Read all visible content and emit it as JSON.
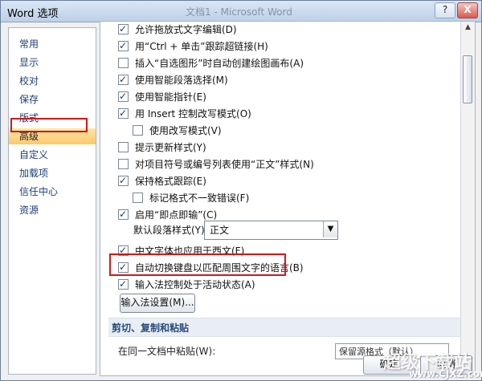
{
  "window": {
    "title": "Word 选项",
    "ghost_title": "文档1 - Microsoft Word"
  },
  "sysbuttons": {
    "help": "?",
    "close": "X"
  },
  "nav": [
    {
      "label": "常用"
    },
    {
      "label": "显示"
    },
    {
      "label": "校对"
    },
    {
      "label": "保存"
    },
    {
      "label": "版式"
    },
    {
      "label": "高级"
    },
    {
      "label": "自定义"
    },
    {
      "label": "加载项"
    },
    {
      "label": "信任中心"
    },
    {
      "label": "资源"
    }
  ],
  "options": [
    {
      "text": "允许拖放式文字编辑(D)",
      "checked": true
    },
    {
      "text": "用“Ctrl + 单击”跟踪超链接(H)",
      "checked": true
    },
    {
      "text": "插入“自选图形”时自动创建绘图画布(A)",
      "checked": false
    },
    {
      "text": "使用智能段落选择(M)",
      "checked": true
    },
    {
      "text": "使用智能指针(E)",
      "checked": true
    },
    {
      "text": "用 Insert 控制改写模式(O)",
      "checked": true
    },
    {
      "text": "使用改写模式(V)",
      "checked": false
    },
    {
      "text": "提示更新样式(Y)",
      "checked": false
    },
    {
      "text": "对项目符号或编号列表使用“正文”样式(N)",
      "checked": false
    },
    {
      "text": "保持格式跟踪(E)",
      "checked": true
    },
    {
      "text": "标记格式不一致错误(F)",
      "checked": false
    },
    {
      "text": "启用“即点即输”(C)",
      "checked": true
    },
    {
      "text": "中文字体也应用于西文(F)",
      "checked": true
    },
    {
      "text": "自动切换键盘以匹配周围文字的语言(B)",
      "checked": true
    },
    {
      "text": "输入法控制处于活动状态(A)",
      "checked": true
    }
  ],
  "default_paragraph_style": {
    "label": "默认段落样式(Y):",
    "value": "正文"
  },
  "ime_button": "输入法设置(M)...",
  "section_cut_copy_paste": "剪切、复制和粘贴",
  "clipped_row": {
    "text": "在同一文档中粘贴(W):",
    "dropdown": "保留源格式（默认）"
  },
  "buttons": {
    "ok": "确定",
    "cancel": "取消"
  },
  "watermark": {
    "main": "超级下载站",
    "sub": "www.CJXZ.com"
  },
  "accent": {
    "highlight": "#ffc86a",
    "red_frame": "#d01818"
  }
}
